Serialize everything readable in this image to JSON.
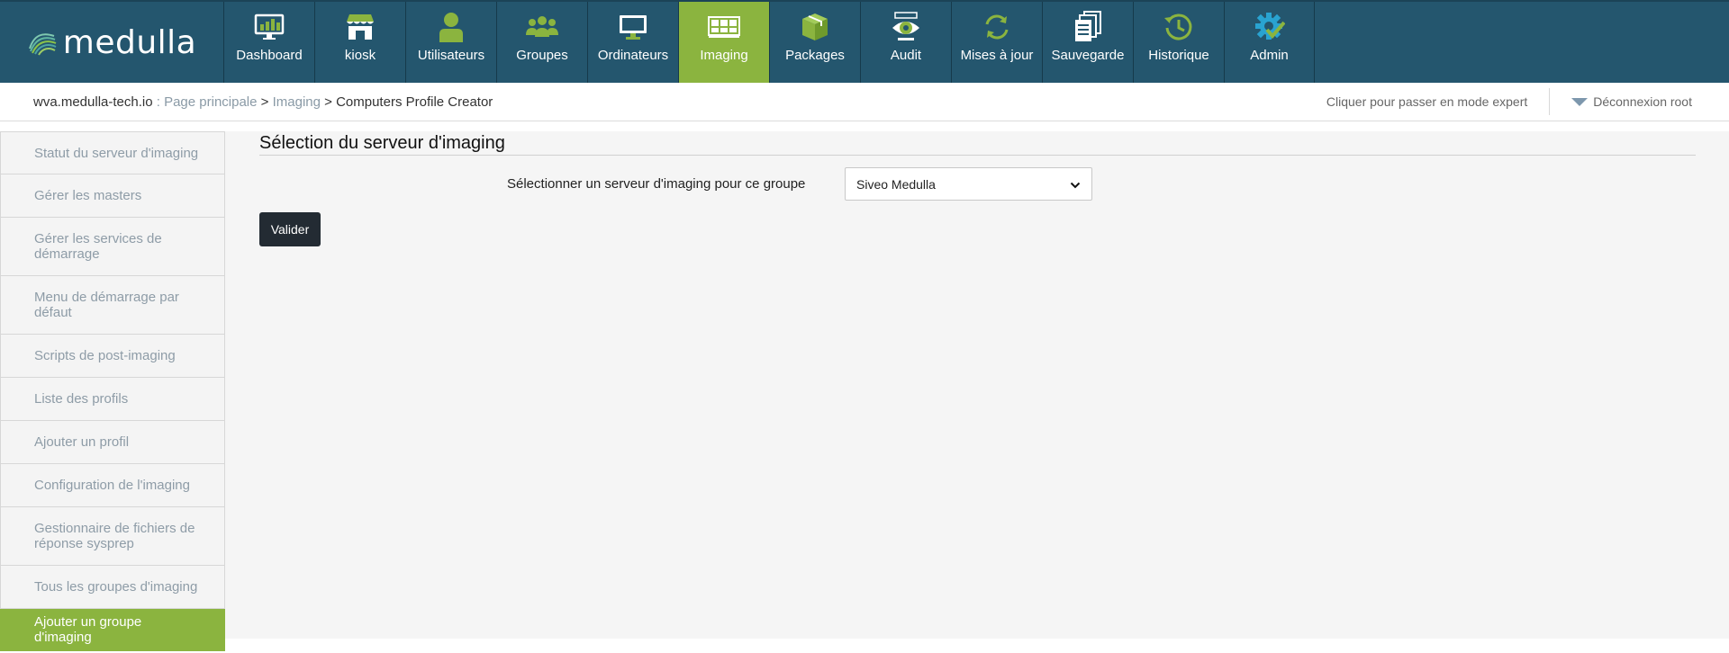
{
  "brand": {
    "name": "medulla"
  },
  "nav": {
    "items": [
      {
        "label": "Dashboard",
        "icon": "dashboard-icon"
      },
      {
        "label": "kiosk",
        "icon": "kiosk-store-icon"
      },
      {
        "label": "Utilisateurs",
        "icon": "user-icon"
      },
      {
        "label": "Groupes",
        "icon": "users-group-icon"
      },
      {
        "label": "Ordinateurs",
        "icon": "monitor-icon"
      },
      {
        "label": "Imaging",
        "icon": "imaging-disk-icon"
      },
      {
        "label": "Packages",
        "icon": "packages-boxes-icon"
      },
      {
        "label": "Audit",
        "icon": "audit-eye-icon"
      },
      {
        "label": "Mises à jour",
        "icon": "refresh-icon"
      },
      {
        "label": "Sauvegarde",
        "icon": "backup-documents-icon"
      },
      {
        "label": "Historique",
        "icon": "history-clock-icon"
      },
      {
        "label": "Admin",
        "icon": "gear-check-icon"
      }
    ],
    "active": "Imaging"
  },
  "breadcrumb": {
    "host": "wva.medulla-tech.io",
    "sep1": " : ",
    "home": "Page principale",
    "sep2": " > ",
    "module": "Imaging",
    "sep3": " > ",
    "current": "Computers Profile Creator"
  },
  "header_links": {
    "expert_mode": "Cliquer pour passer en mode expert",
    "logout": "Déconnexion root"
  },
  "sidebar": {
    "items": [
      {
        "label": "Statut du serveur d'imaging"
      },
      {
        "label": "Gérer les masters"
      },
      {
        "label": "Gérer les services de démarrage"
      },
      {
        "label": "Menu de démarrage par défaut"
      },
      {
        "label": "Scripts de post-imaging"
      },
      {
        "label": "Liste des profils"
      },
      {
        "label": "Ajouter un profil"
      },
      {
        "label": "Configuration de l'imaging"
      },
      {
        "label": "Gestionnaire de fichiers de réponse sysprep"
      },
      {
        "label": "Tous les groupes d'imaging"
      },
      {
        "label": "Ajouter un groupe d'imaging"
      }
    ],
    "active": "Ajouter un groupe d'imaging"
  },
  "main": {
    "section_title": "Sélection du serveur d'imaging",
    "form": {
      "label": "Sélectionner un serveur d'imaging pour ce groupe",
      "selected_value": "Siveo Medulla"
    },
    "submit_label": "Valider"
  },
  "colors": {
    "topbar": "#24566e",
    "accent_green": "#8bb43f",
    "button_dark": "#232b33"
  }
}
